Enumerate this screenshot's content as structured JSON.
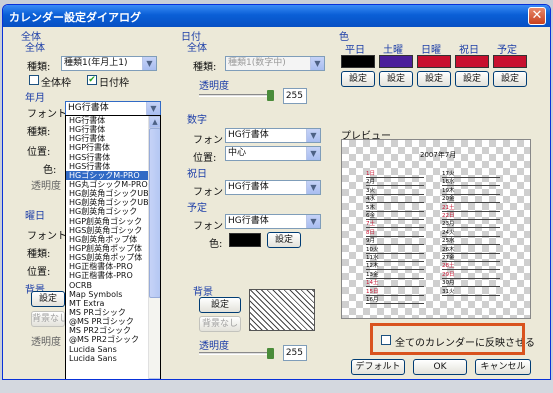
{
  "window": {
    "title": "カレンダー設定ダイアログ",
    "close_glyph": "✕"
  },
  "overall": {
    "section_label": "全体",
    "group_label": "全体",
    "kind_label": "種類:",
    "kind_value": "種類1(年月上1)",
    "checkbox_all_frame_label": "全体枠",
    "checkbox_all_frame_checked": false,
    "checkbox_day_frame_label": "日付枠",
    "checkbox_day_frame_checked": true
  },
  "year_month": {
    "group_label": "年月",
    "font_label": "フォント:",
    "font_value": "HG行書体",
    "kind_label": "種類:",
    "position_label": "位置:",
    "color_label": "色:",
    "opacity_label": "透明度"
  },
  "weekday": {
    "group_label": "曜日",
    "font_label": "フォント:",
    "kind_label": "種類:",
    "position_label": "位置:"
  },
  "left_background": {
    "group_label": "背景",
    "settings_button": "設定",
    "none_button": "背景なし",
    "opacity_label": "透明度"
  },
  "font_list": {
    "items": [
      "HG行書体",
      "HG行書体",
      "HG行書体",
      "HGP行書体",
      "HGS行書体",
      "HGS行書体",
      "HGゴシックM-PRO",
      "HG丸ゴシックM-PRO",
      "HG創英角ゴシックUB",
      "HG創英角ゴシックUB",
      "HG創英角ゴシック",
      "HGP創英角ゴシック",
      "HGS創英角ゴシック",
      "HG創英角ポップ体",
      "HGP創英角ポップ体",
      "HGS創英角ポップ体",
      "HG正楷書体-PRO",
      "HG正楷書体-PRO",
      "OCRB",
      "Map Symbols",
      "MT Extra",
      "MS PRゴシック",
      "@MS PRゴシック",
      "MS PR2ゴシック",
      "@MS PR2ゴシック",
      "Lucida Sans",
      "Lucida Sans"
    ],
    "selected_index": 6
  },
  "date": {
    "section_label": "日付",
    "group_label": "全体",
    "kind_label": "種類:",
    "kind_value": "種類1(数字中)",
    "opacity_label": "透明度",
    "opacity_value": "255",
    "opacity_fraction": 1.0
  },
  "number": {
    "group_label": "数字",
    "font_label": "フォント:",
    "font_value": "HG行書体",
    "position_label": "位置:",
    "position_value": "中心"
  },
  "holiday": {
    "group_label": "祝日",
    "font_label": "フォント:",
    "font_value": "HG行書体"
  },
  "schedule": {
    "group_label": "予定",
    "font_label": "フォント:",
    "font_value": "HG行書体",
    "color_label": "色:",
    "color_value": "#000000",
    "settings_button": "設定"
  },
  "mid_background": {
    "group_label": "背景",
    "settings_button": "設定",
    "none_button": "背景なし",
    "opacity_label": "透明度",
    "opacity_value": "255",
    "opacity_fraction": 1.0
  },
  "colors": {
    "section_label": "色",
    "items": [
      {
        "label": "平日",
        "color": "#000000",
        "button": "設定"
      },
      {
        "label": "土曜",
        "color": "#4b1f9a",
        "button": "設定"
      },
      {
        "label": "日曜",
        "color": "#c8102e",
        "button": "設定"
      },
      {
        "label": "祝日",
        "color": "#c8102e",
        "button": "設定"
      },
      {
        "label": "予定",
        "color": "#c8102e",
        "button": "設定"
      }
    ]
  },
  "preview": {
    "label": "プレビュー",
    "calendar_title": "2007年7月",
    "left_rows": [
      "1日",
      "2月",
      "3火",
      "4水",
      "5木",
      "6金",
      "7土",
      "8日",
      "9月",
      "10火",
      "11水",
      "12木",
      "13金",
      "14土",
      "15日",
      "16月"
    ],
    "right_rows": [
      "17火",
      "18水",
      "19木",
      "20金",
      "21土",
      "22日",
      "23月",
      "24火",
      "25水",
      "26木",
      "27金",
      "28土",
      "29日",
      "30月",
      "31火"
    ]
  },
  "apply_all": {
    "label": "全てのカレンダーに反映させる",
    "checked": false
  },
  "footer": {
    "default_button": "デフォルト",
    "ok_button": "OK",
    "cancel_button": "キャンセル"
  }
}
